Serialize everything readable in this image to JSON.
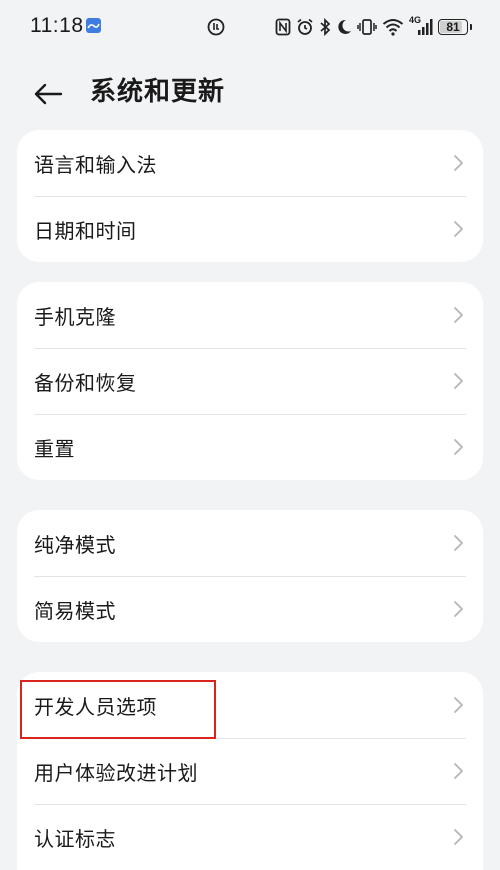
{
  "status_bar": {
    "time": "11:18",
    "battery_level": "81",
    "network_label": "4G"
  },
  "header": {
    "title": "系统和更新"
  },
  "groups": [
    {
      "items": [
        {
          "label": "语言和输入法"
        },
        {
          "label": "日期和时间"
        }
      ]
    },
    {
      "items": [
        {
          "label": "手机克隆"
        },
        {
          "label": "备份和恢复"
        },
        {
          "label": "重置"
        }
      ]
    },
    {
      "items": [
        {
          "label": "纯净模式"
        },
        {
          "label": "简易模式"
        }
      ]
    },
    {
      "items": [
        {
          "label": "开发人员选项"
        },
        {
          "label": "用户体验改进计划"
        },
        {
          "label": "认证标志"
        }
      ]
    }
  ],
  "colors": {
    "background": "#f1f3f5",
    "card": "#ffffff",
    "highlight": "#d9251d"
  }
}
